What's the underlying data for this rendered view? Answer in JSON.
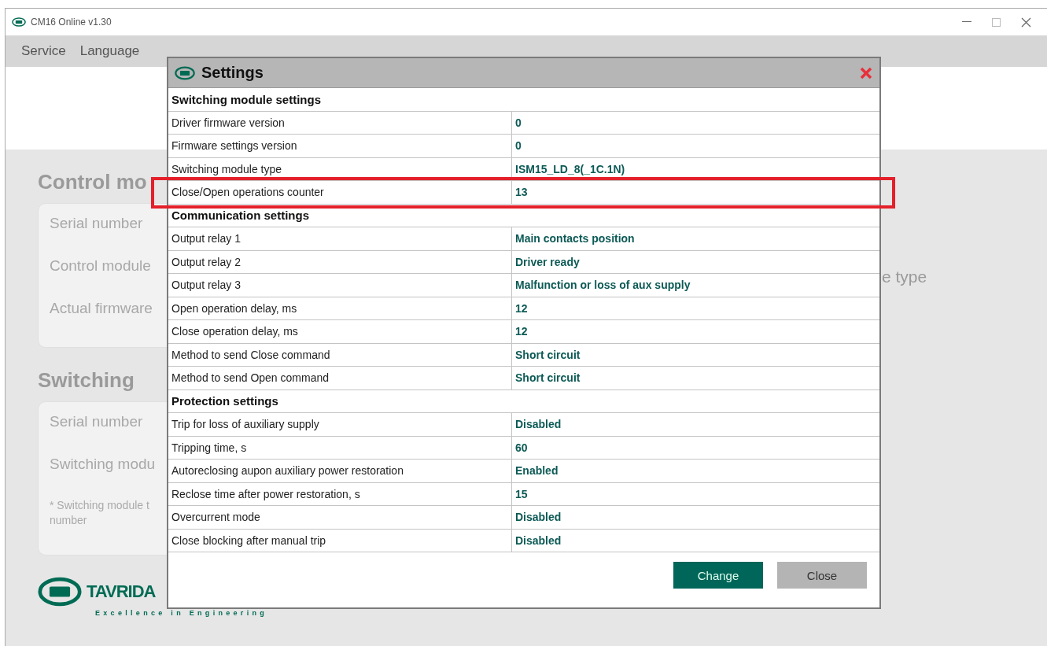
{
  "window": {
    "title": "CM16 Online v1.30"
  },
  "menu": [
    "Service",
    "Language"
  ],
  "background": {
    "control_heading": "Control mo",
    "control_fields": [
      "Serial number",
      "Control module",
      "Actual firmware"
    ],
    "right_field": "e type",
    "switching_heading": "Switching",
    "switching_fields": [
      "Serial number",
      "Switching modu"
    ],
    "footnote": [
      "* Switching module t",
      "number"
    ],
    "logo": {
      "name": "TAVRIDA",
      "slogan": "Excellence in Engineering"
    }
  },
  "dialog": {
    "title": "Settings",
    "sections": [
      {
        "title": "Switching module settings",
        "rows": [
          {
            "label": "Driver firmware version",
            "value": "0",
            "highlighted": false
          },
          {
            "label": "Firmware settings version",
            "value": "0",
            "highlighted": false
          },
          {
            "label": "Switching module type",
            "value": "ISM15_LD_8(_1C.1N)",
            "highlighted": false
          },
          {
            "label": "Close/Open operations counter",
            "value": "13",
            "highlighted": true
          }
        ]
      },
      {
        "title": "Communication settings",
        "rows": [
          {
            "label": "Output relay 1",
            "value": "Main contacts position",
            "highlighted": false
          },
          {
            "label": "Output relay 2",
            "value": "Driver ready",
            "highlighted": false
          },
          {
            "label": "Output relay 3",
            "value": "Malfunction or loss of aux supply",
            "highlighted": false
          },
          {
            "label": "Open operation delay, ms",
            "value": "12",
            "highlighted": false
          },
          {
            "label": "Close operation delay, ms",
            "value": "12",
            "highlighted": false
          },
          {
            "label": "Method to send Close command",
            "value": "Short circuit",
            "highlighted": false
          },
          {
            "label": "Method to send Open command",
            "value": "Short circuit",
            "highlighted": false
          }
        ]
      },
      {
        "title": "Protection settings",
        "rows": [
          {
            "label": "Trip for loss of auxiliary supply",
            "value": "Disabled",
            "highlighted": false
          },
          {
            "label": "Tripping time, s",
            "value": "60",
            "highlighted": false
          },
          {
            "label": "Autoreclosing aupon auxiliary power restoration",
            "value": "Enabled",
            "highlighted": false
          },
          {
            "label": "Reclose time after power restoration, s",
            "value": "15",
            "highlighted": false
          },
          {
            "label": "Overcurrent mode",
            "value": "Disabled",
            "highlighted": false
          },
          {
            "label": "Close blocking after manual trip",
            "value": "Disabled",
            "highlighted": false
          }
        ]
      }
    ],
    "buttons": [
      {
        "label": "Change",
        "kind": "primary"
      },
      {
        "label": "Close",
        "kind": "secondary"
      }
    ]
  }
}
